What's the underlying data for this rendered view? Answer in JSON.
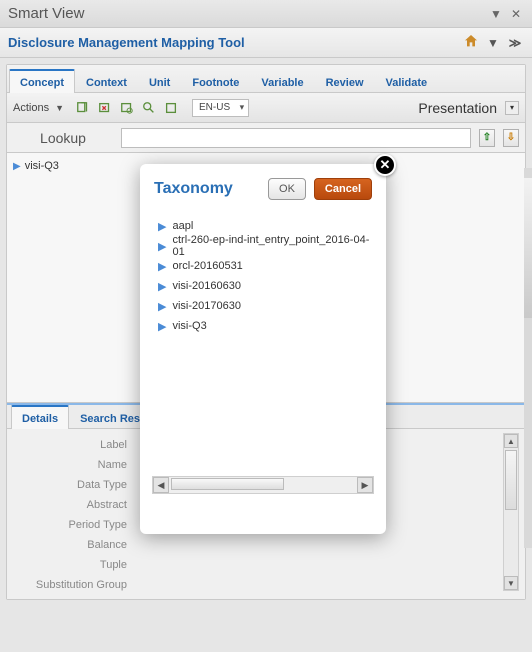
{
  "header": {
    "title": "Smart View"
  },
  "toolbar": {
    "title": "Disclosure Management Mapping Tool"
  },
  "tabs": {
    "items": [
      {
        "label": "Concept"
      },
      {
        "label": "Context"
      },
      {
        "label": "Unit"
      },
      {
        "label": "Footnote"
      },
      {
        "label": "Variable"
      },
      {
        "label": "Review"
      },
      {
        "label": "Validate"
      }
    ],
    "active_index": 0
  },
  "actions": {
    "label": "Actions",
    "language": "EN-US",
    "presentation_label": "Presentation"
  },
  "lookup": {
    "label": "Lookup",
    "value": ""
  },
  "tree": {
    "items": [
      {
        "label": "visi-Q3"
      }
    ]
  },
  "lower_tabs": {
    "items": [
      {
        "label": "Details"
      },
      {
        "label": "Search Resu"
      }
    ],
    "active_index": 0
  },
  "details": {
    "rows": [
      {
        "label": "Label"
      },
      {
        "label": "Name"
      },
      {
        "label": "Data Type"
      },
      {
        "label": "Abstract"
      },
      {
        "label": "Period Type"
      },
      {
        "label": "Balance"
      },
      {
        "label": "Tuple"
      },
      {
        "label": "Substitution Group"
      }
    ]
  },
  "dialog": {
    "title": "Taxonomy",
    "ok_label": "OK",
    "cancel_label": "Cancel",
    "items": [
      {
        "label": "aapl"
      },
      {
        "label": "ctrl-260-ep-ind-int_entry_point_2016-04-01"
      },
      {
        "label": "orcl-20160531"
      },
      {
        "label": "visi-20160630"
      },
      {
        "label": "visi-20170630"
      },
      {
        "label": "visi-Q3"
      }
    ]
  }
}
